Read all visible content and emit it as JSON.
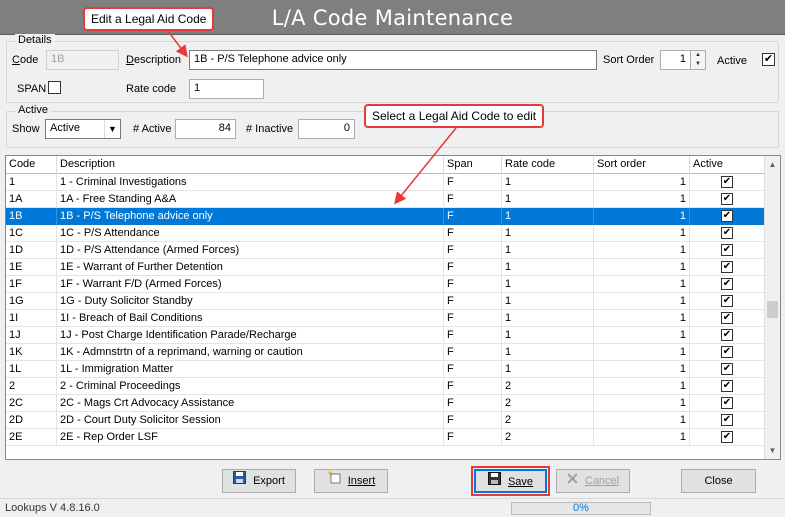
{
  "window": {
    "title": "L/A Code Maintenance"
  },
  "callouts": {
    "edit": "Edit a Legal Aid Code",
    "select": "Select a Legal Aid Code to edit"
  },
  "details": {
    "legend": "Details",
    "code_label": "Code",
    "code_value": "1B",
    "description_label": "Description",
    "description_value": "1B - P/S Telephone advice only",
    "sort_order_label": "Sort Order",
    "sort_order_value": "1",
    "active_label": "Active",
    "active_checked": true,
    "span_label": "SPAN",
    "span_checked": false,
    "rate_code_label": "Rate code",
    "rate_code_value": "1"
  },
  "active_group": {
    "legend": "Active",
    "show_label": "Show",
    "show_value": "Active",
    "active_count_label": "# Active",
    "active_count": "84",
    "inactive_count_label": "# Inactive",
    "inactive_count": "0"
  },
  "grid": {
    "columns": [
      "Code",
      "Description",
      "Span",
      "Rate code",
      "Sort order",
      "Active"
    ],
    "rows": [
      {
        "code": "1",
        "description": "1 - Criminal Investigations",
        "span": "F",
        "rate_code": "1",
        "sort_order": "1",
        "active": true
      },
      {
        "code": "1A",
        "description": "1A - Free Standing A&A",
        "span": "F",
        "rate_code": "1",
        "sort_order": "1",
        "active": true
      },
      {
        "code": "1B",
        "description": "1B - P/S Telephone advice only",
        "span": "F",
        "rate_code": "1",
        "sort_order": "1",
        "active": true,
        "selected": true
      },
      {
        "code": "1C",
        "description": "1C - P/S Attendance",
        "span": "F",
        "rate_code": "1",
        "sort_order": "1",
        "active": true
      },
      {
        "code": "1D",
        "description": "1D - P/S Attendance (Armed Forces)",
        "span": "F",
        "rate_code": "1",
        "sort_order": "1",
        "active": true
      },
      {
        "code": "1E",
        "description": "1E - Warrant of Further Detention",
        "span": "F",
        "rate_code": "1",
        "sort_order": "1",
        "active": true
      },
      {
        "code": "1F",
        "description": "1F - Warrant F/D (Armed Forces)",
        "span": "F",
        "rate_code": "1",
        "sort_order": "1",
        "active": true
      },
      {
        "code": "1G",
        "description": "1G - Duty Solicitor Standby",
        "span": "F",
        "rate_code": "1",
        "sort_order": "1",
        "active": true
      },
      {
        "code": "1I",
        "description": "1I - Breach of Bail Conditions",
        "span": "F",
        "rate_code": "1",
        "sort_order": "1",
        "active": true
      },
      {
        "code": "1J",
        "description": "1J - Post Charge Identification Parade/Recharge",
        "span": "F",
        "rate_code": "1",
        "sort_order": "1",
        "active": true
      },
      {
        "code": "1K",
        "description": "1K - Admnstrtn of a reprimand, warning or caution",
        "span": "F",
        "rate_code": "1",
        "sort_order": "1",
        "active": true
      },
      {
        "code": "1L",
        "description": "1L - Immigration Matter",
        "span": "F",
        "rate_code": "1",
        "sort_order": "1",
        "active": true
      },
      {
        "code": "2",
        "description": "2 - Criminal Proceedings",
        "span": "F",
        "rate_code": "2",
        "sort_order": "1",
        "active": true
      },
      {
        "code": "2C",
        "description": "2C - Mags Crt Advocacy Assistance",
        "span": "F",
        "rate_code": "2",
        "sort_order": "1",
        "active": true
      },
      {
        "code": "2D",
        "description": "2D - Court Duty Solicitor Session",
        "span": "F",
        "rate_code": "2",
        "sort_order": "1",
        "active": true
      },
      {
        "code": "2E",
        "description": "2E - Rep Order LSF",
        "span": "F",
        "rate_code": "2",
        "sort_order": "1",
        "active": true
      }
    ]
  },
  "buttons": {
    "export": "Export",
    "insert": "Insert",
    "save": "Save",
    "cancel": "Cancel",
    "close": "Close"
  },
  "icons": {
    "export": "floppy-disk-icon",
    "insert": "insert-sparkle-icon",
    "save": "floppy-disk-icon",
    "cancel": "x-icon"
  },
  "status": {
    "version": "Lookups V 4.8.16.0",
    "progress_text": "0%",
    "progress_fraction": 0
  },
  "colors": {
    "title_bar": "#7f7f7f",
    "selection": "#0078d7",
    "callout_border": "#e53a3a",
    "progress_text": "#0078d7"
  }
}
